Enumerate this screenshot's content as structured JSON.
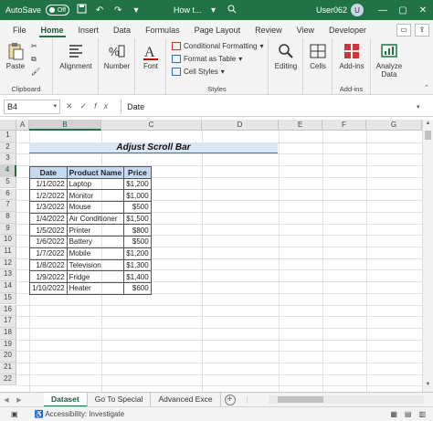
{
  "titlebar": {
    "autosave": "AutoSave",
    "toggle": "Off",
    "doc": "How t...",
    "user": "User062",
    "avatar": "U"
  },
  "tabs": [
    "File",
    "Home",
    "Insert",
    "Data",
    "Formulas",
    "Page Layout",
    "Review",
    "View",
    "Developer"
  ],
  "ribbon": {
    "paste": "Paste",
    "clipboard": "Clipboard",
    "alignment": "Alignment",
    "number": "Number",
    "font": "Font",
    "conditional": "Conditional Formatting",
    "format_table": "Format as Table",
    "cell_styles": "Cell Styles",
    "styles": "Styles",
    "editing": "Editing",
    "cells": "Cells",
    "addins_btn": "Add-ins",
    "addins_group": "Add-ins",
    "analyze": "Analyze",
    "data": "Data"
  },
  "formula_bar": {
    "name_box": "B4",
    "fx": "fx",
    "value": "Date"
  },
  "columns": [
    "A",
    "B",
    "C",
    "D",
    "E",
    "F",
    "G"
  ],
  "rows": [
    "1",
    "2",
    "3",
    "4",
    "5",
    "6",
    "7",
    "8",
    "9",
    "10",
    "11",
    "12",
    "13",
    "14",
    "15",
    "16",
    "17",
    "18",
    "19",
    "20",
    "21",
    "22"
  ],
  "sheet": {
    "title": "Adjust Scroll Bar",
    "headers": [
      "Date",
      "Product Name",
      "Price"
    ],
    "records": [
      [
        "1/1/2022",
        "Laptop",
        "$1,200"
      ],
      [
        "1/2/2022",
        "Monitor",
        "$1,000"
      ],
      [
        "1/3/2022",
        "Mouse",
        "$500"
      ],
      [
        "1/4/2022",
        "Air Conditioner",
        "$1,500"
      ],
      [
        "1/5/2022",
        "Printer",
        "$800"
      ],
      [
        "1/6/2022",
        "Battery",
        "$500"
      ],
      [
        "1/7/2022",
        "Mobile",
        "$1,200"
      ],
      [
        "1/8/2022",
        "Television",
        "$1,300"
      ],
      [
        "1/9/2022",
        "Fridge",
        "$1,400"
      ],
      [
        "1/10/2022",
        "Heater",
        "$600"
      ]
    ]
  },
  "sheet_tabs": [
    "Dataset",
    "Go To Special",
    "Advanced Exce"
  ],
  "status": {
    "accessibility": "Accessibility: Investigate"
  },
  "colors": {
    "accent": "#217346",
    "header_fill": "#c5d9f1",
    "title_fill": "#dae6f3"
  }
}
